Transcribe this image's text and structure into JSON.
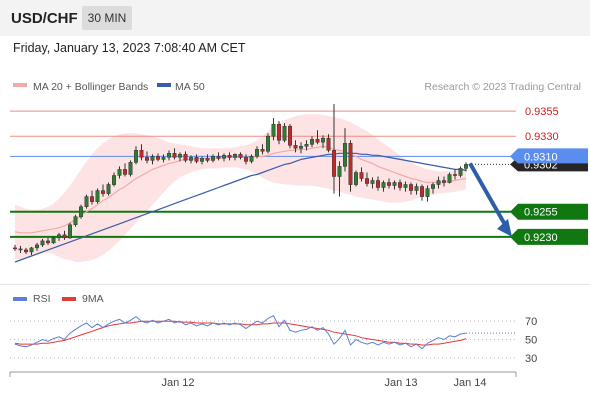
{
  "header": {
    "symbol": "USD/CHF",
    "timeframe": "30 MIN",
    "datetime": "Friday, January 13, 2023 7:08:40 AM CET"
  },
  "legend": {
    "ma20_bb": "MA 20 + Bollinger Bands",
    "ma50": "MA 50",
    "credit": "Research © 2023 Trading Central",
    "rsi": "RSI",
    "rsi_ma": "9MA"
  },
  "colors": {
    "candle_up": "#2e7d32",
    "candle_down": "#c62828",
    "ma20": "#f4a9a9",
    "ma50": "#3b5ca8",
    "bollinger_fill": "#fde3e3",
    "resistance": "#f28b82",
    "support": "#117711",
    "pivot": "#5b8def",
    "arrow": "#2f5ea8",
    "rsi": "#5b7fd6",
    "rsi_ma": "#e53935"
  },
  "chart_data": [
    {
      "type": "candlestick",
      "title": "USD/CHF 30 MIN",
      "ylim": [
        0.9205,
        0.9368
      ],
      "candles": [
        [
          0.9219,
          0.9222,
          0.9216,
          0.9218
        ],
        [
          0.9218,
          0.9221,
          0.9214,
          0.9217
        ],
        [
          0.9217,
          0.9219,
          0.9213,
          0.9215
        ],
        [
          0.9215,
          0.922,
          0.9212,
          0.9219
        ],
        [
          0.9219,
          0.9224,
          0.9216,
          0.9222
        ],
        [
          0.9222,
          0.9228,
          0.922,
          0.9226
        ],
        [
          0.9226,
          0.9229,
          0.9222,
          0.9224
        ],
        [
          0.9224,
          0.923,
          0.9223,
          0.9229
        ],
        [
          0.9229,
          0.9234,
          0.9226,
          0.9232
        ],
        [
          0.9232,
          0.9236,
          0.9227,
          0.9229
        ],
        [
          0.9229,
          0.9244,
          0.9228,
          0.9242
        ],
        [
          0.9242,
          0.9252,
          0.924,
          0.925
        ],
        [
          0.925,
          0.9262,
          0.9248,
          0.926
        ],
        [
          0.926,
          0.9272,
          0.9258,
          0.927
        ],
        [
          0.927,
          0.9276,
          0.9262,
          0.9265
        ],
        [
          0.9265,
          0.9278,
          0.9263,
          0.9276
        ],
        [
          0.9276,
          0.9282,
          0.927,
          0.9273
        ],
        [
          0.9273,
          0.9284,
          0.9271,
          0.9282
        ],
        [
          0.9282,
          0.9294,
          0.928,
          0.9291
        ],
        [
          0.9291,
          0.93,
          0.9288,
          0.9297
        ],
        [
          0.9297,
          0.9303,
          0.929,
          0.9292
        ],
        [
          0.9292,
          0.9306,
          0.929,
          0.9304
        ],
        [
          0.9304,
          0.932,
          0.9302,
          0.9316
        ],
        [
          0.9316,
          0.9322,
          0.9306,
          0.9309
        ],
        [
          0.9309,
          0.9315,
          0.9303,
          0.9306
        ],
        [
          0.9306,
          0.9312,
          0.9302,
          0.931
        ],
        [
          0.931,
          0.9313,
          0.9305,
          0.9307
        ],
        [
          0.9307,
          0.9312,
          0.9304,
          0.9309
        ],
        [
          0.9309,
          0.9316,
          0.9306,
          0.9313
        ],
        [
          0.9313,
          0.9318,
          0.9307,
          0.9309
        ],
        [
          0.9309,
          0.9314,
          0.9305,
          0.9312
        ],
        [
          0.9312,
          0.9315,
          0.9304,
          0.9306
        ],
        [
          0.9306,
          0.9311,
          0.9303,
          0.9309
        ],
        [
          0.9309,
          0.9312,
          0.9303,
          0.9305
        ],
        [
          0.9305,
          0.931,
          0.9302,
          0.9308
        ],
        [
          0.9308,
          0.9312,
          0.9304,
          0.9306
        ],
        [
          0.9306,
          0.9312,
          0.9304,
          0.931
        ],
        [
          0.931,
          0.9314,
          0.9306,
          0.9308
        ],
        [
          0.9308,
          0.9313,
          0.9305,
          0.9311
        ],
        [
          0.9311,
          0.9314,
          0.9306,
          0.9309
        ],
        [
          0.9309,
          0.9313,
          0.9306,
          0.9312
        ],
        [
          0.9312,
          0.9314,
          0.9307,
          0.9309
        ],
        [
          0.9309,
          0.9312,
          0.9302,
          0.9305
        ],
        [
          0.9305,
          0.9312,
          0.9303,
          0.931
        ],
        [
          0.931,
          0.932,
          0.9308,
          0.9317
        ],
        [
          0.9317,
          0.9322,
          0.9312,
          0.9315
        ],
        [
          0.9315,
          0.9333,
          0.9313,
          0.933
        ],
        [
          0.933,
          0.9348,
          0.9326,
          0.9342
        ],
        [
          0.9342,
          0.9345,
          0.9322,
          0.9326
        ],
        [
          0.9326,
          0.9343,
          0.9324,
          0.934
        ],
        [
          0.934,
          0.9342,
          0.9318,
          0.9321
        ],
        [
          0.9321,
          0.9326,
          0.9314,
          0.9318
        ],
        [
          0.9318,
          0.9324,
          0.9313,
          0.932
        ],
        [
          0.932,
          0.9326,
          0.9316,
          0.9322
        ],
        [
          0.9322,
          0.933,
          0.9319,
          0.9327
        ],
        [
          0.9327,
          0.9336,
          0.9322,
          0.9324
        ],
        [
          0.9324,
          0.9331,
          0.9318,
          0.9328
        ],
        [
          0.9328,
          0.9332,
          0.9314,
          0.9316
        ],
        [
          0.9316,
          0.9362,
          0.9273,
          0.929
        ],
        [
          0.929,
          0.9305,
          0.927,
          0.93
        ],
        [
          0.93,
          0.9338,
          0.9295,
          0.9323
        ],
        [
          0.9323,
          0.9326,
          0.9275,
          0.9282
        ],
        [
          0.9282,
          0.9296,
          0.928,
          0.9294
        ],
        [
          0.9294,
          0.9299,
          0.9285,
          0.9288
        ],
        [
          0.9288,
          0.9294,
          0.928,
          0.9283
        ],
        [
          0.9283,
          0.9289,
          0.9278,
          0.9286
        ],
        [
          0.9286,
          0.929,
          0.9276,
          0.9279
        ],
        [
          0.9279,
          0.9286,
          0.9275,
          0.9284
        ],
        [
          0.9284,
          0.9288,
          0.9278,
          0.9281
        ],
        [
          0.9281,
          0.9286,
          0.9277,
          0.9284
        ],
        [
          0.9284,
          0.9287,
          0.9276,
          0.9279
        ],
        [
          0.9279,
          0.9285,
          0.9275,
          0.9282
        ],
        [
          0.9282,
          0.9284,
          0.9272,
          0.9276
        ],
        [
          0.9276,
          0.9283,
          0.9272,
          0.928
        ],
        [
          0.928,
          0.9282,
          0.9266,
          0.927
        ],
        [
          0.927,
          0.9281,
          0.9265,
          0.9278
        ],
        [
          0.9278,
          0.9284,
          0.9273,
          0.9282
        ],
        [
          0.9282,
          0.929,
          0.9278,
          0.9286
        ],
        [
          0.9286,
          0.929,
          0.928,
          0.9284
        ],
        [
          0.9284,
          0.9294,
          0.9283,
          0.9292
        ],
        [
          0.9292,
          0.9297,
          0.9287,
          0.9291
        ],
        [
          0.9291,
          0.93,
          0.9289,
          0.9298
        ],
        [
          0.9298,
          0.9304,
          0.9295,
          0.9302
        ]
      ],
      "ma20": [
        0.9235,
        0.9234,
        0.9234,
        0.9234,
        0.9235,
        0.9236,
        0.9237,
        0.9238,
        0.9239,
        0.9241,
        0.9244,
        0.9247,
        0.9251,
        0.9255,
        0.9258,
        0.9262,
        0.9266,
        0.9269,
        0.9273,
        0.9277,
        0.928,
        0.9284,
        0.9288,
        0.9291,
        0.9294,
        0.9297,
        0.9299,
        0.9301,
        0.9303,
        0.9304,
        0.9306,
        0.9307,
        0.9307,
        0.9308,
        0.9308,
        0.9308,
        0.9308,
        0.9308,
        0.9309,
        0.9309,
        0.9309,
        0.9309,
        0.9309,
        0.9309,
        0.931,
        0.931,
        0.9311,
        0.9313,
        0.9314,
        0.9315,
        0.9316,
        0.9316,
        0.9317,
        0.9317,
        0.9318,
        0.9319,
        0.932,
        0.9319,
        0.9317,
        0.9316,
        0.9315,
        0.9312,
        0.931,
        0.9307,
        0.9305,
        0.9303,
        0.93,
        0.9298,
        0.9296,
        0.9294,
        0.9292,
        0.929,
        0.9288,
        0.9287,
        0.9285,
        0.9284,
        0.9284,
        0.9284,
        0.9284,
        0.9285,
        0.9286,
        0.9287,
        0.9288
      ],
      "ma50": [
        0.9205,
        0.9207,
        0.9209,
        0.9211,
        0.9213,
        0.9215,
        0.9217,
        0.9219,
        0.9221,
        0.9223,
        0.9225,
        0.9227,
        0.9229,
        0.9231,
        0.9233,
        0.9235,
        0.9237,
        0.9239,
        0.9241,
        0.9243,
        0.9245,
        0.9247,
        0.9249,
        0.9251,
        0.9253,
        0.9255,
        0.9257,
        0.9259,
        0.9261,
        0.9263,
        0.9265,
        0.9267,
        0.9269,
        0.9271,
        0.9273,
        0.9275,
        0.9277,
        0.9279,
        0.9281,
        0.9283,
        0.9285,
        0.9287,
        0.9289,
        0.9291,
        0.9292,
        0.9294,
        0.9296,
        0.9298,
        0.93,
        0.9302,
        0.9303,
        0.9305,
        0.9307,
        0.9308,
        0.9309,
        0.931,
        0.9311,
        0.9312,
        0.9312,
        0.9313,
        0.9313,
        0.9313,
        0.9313,
        0.9312,
        0.9312,
        0.9311,
        0.9311,
        0.931,
        0.9309,
        0.9308,
        0.9307,
        0.9306,
        0.9305,
        0.9304,
        0.9303,
        0.9302,
        0.9301,
        0.93,
        0.9299,
        0.9298,
        0.9297,
        0.9297,
        0.9296
      ],
      "bb_upper": [
        0.9262,
        0.926,
        0.9258,
        0.9257,
        0.9257,
        0.9258,
        0.926,
        0.9263,
        0.9268,
        0.9274,
        0.9281,
        0.9289,
        0.9297,
        0.9305,
        0.9312,
        0.9318,
        0.9323,
        0.9327,
        0.933,
        0.9332,
        0.9333,
        0.9333,
        0.9333,
        0.9332,
        0.9331,
        0.933,
        0.9328,
        0.9326,
        0.9324,
        0.9323,
        0.9322,
        0.9321,
        0.932,
        0.9319,
        0.9318,
        0.9318,
        0.9318,
        0.9318,
        0.9318,
        0.9318,
        0.9319,
        0.932,
        0.9321,
        0.9323,
        0.9326,
        0.933,
        0.9335,
        0.934,
        0.9343,
        0.9346,
        0.9348,
        0.935,
        0.9351,
        0.9352,
        0.9352,
        0.9352,
        0.9351,
        0.935,
        0.9349,
        0.9348,
        0.9346,
        0.9344,
        0.9341,
        0.9338,
        0.9335,
        0.9331,
        0.9327,
        0.9323,
        0.9319,
        0.9315,
        0.9311,
        0.9307,
        0.9304,
        0.9301,
        0.9299,
        0.9297,
        0.9296,
        0.9295,
        0.9295,
        0.9295,
        0.9296,
        0.9297,
        0.9298
      ],
      "bb_lower": [
        0.9208,
        0.9208,
        0.921,
        0.9211,
        0.9213,
        0.9214,
        0.9214,
        0.9213,
        0.921,
        0.9208,
        0.9207,
        0.9205,
        0.9205,
        0.9206,
        0.9207,
        0.9209,
        0.9212,
        0.9216,
        0.9221,
        0.9226,
        0.9232,
        0.9238,
        0.9244,
        0.925,
        0.9256,
        0.9262,
        0.9268,
        0.9274,
        0.928,
        0.9285,
        0.9289,
        0.9292,
        0.9294,
        0.9296,
        0.9297,
        0.9298,
        0.9298,
        0.9298,
        0.9299,
        0.9299,
        0.9299,
        0.9298,
        0.9297,
        0.9295,
        0.9292,
        0.9289,
        0.9286,
        0.9284,
        0.9283,
        0.9282,
        0.9282,
        0.9281,
        0.9281,
        0.9281,
        0.9281,
        0.928,
        0.9279,
        0.9278,
        0.9276,
        0.9275,
        0.9273,
        0.9272,
        0.927,
        0.9269,
        0.9268,
        0.9267,
        0.9266,
        0.9265,
        0.9264,
        0.9264,
        0.9264,
        0.9265,
        0.9266,
        0.9268,
        0.927,
        0.9271,
        0.9272,
        0.9273,
        0.9274,
        0.9274,
        0.9275,
        0.9276,
        0.9277
      ],
      "levels": [
        {
          "label": "0.9355",
          "value": 0.9355,
          "kind": "resistance"
        },
        {
          "label": "0.9330",
          "value": 0.933,
          "kind": "resistance"
        },
        {
          "label": "0.9310",
          "value": 0.931,
          "kind": "pivot"
        },
        {
          "label": "0.9255",
          "value": 0.9255,
          "kind": "support"
        },
        {
          "label": "0.9230",
          "value": 0.923,
          "kind": "support"
        }
      ],
      "last_price": {
        "label": "0.9302",
        "value": 0.9302
      },
      "forecast_arrow": {
        "from": 0.9303,
        "to": 0.923,
        "direction": "down"
      }
    },
    {
      "type": "line",
      "title": "RSI",
      "ylim": [
        20,
        80
      ],
      "yticks": [
        "70",
        "50",
        "30"
      ],
      "ytick_values": [
        70,
        50,
        30
      ],
      "series": [
        {
          "name": "RSI",
          "values": [
            45,
            43,
            42,
            44,
            47,
            50,
            48,
            51,
            53,
            50,
            57,
            61,
            65,
            68,
            63,
            67,
            63,
            67,
            70,
            72,
            68,
            71,
            75,
            70,
            68,
            71,
            68,
            70,
            72,
            68,
            70,
            66,
            68,
            65,
            67,
            65,
            68,
            66,
            68,
            66,
            68,
            66,
            62,
            66,
            70,
            68,
            73,
            76,
            64,
            71,
            60,
            58,
            60,
            61,
            64,
            60,
            63,
            56,
            45,
            51,
            60,
            44,
            50,
            47,
            45,
            47,
            44,
            47,
            45,
            47,
            44,
            46,
            42,
            45,
            40,
            46,
            49,
            52,
            50,
            54,
            53,
            56,
            57
          ]
        },
        {
          "name": "9MA",
          "values": [
            46,
            45,
            45,
            45,
            45,
            46,
            46,
            47,
            48,
            49,
            51,
            53,
            55,
            57,
            59,
            61,
            63,
            65,
            66,
            67,
            68,
            68,
            69,
            70,
            70,
            70,
            70,
            70,
            70,
            70,
            69,
            69,
            69,
            68,
            68,
            68,
            68,
            67,
            67,
            67,
            67,
            67,
            66,
            66,
            66,
            67,
            67,
            68,
            68,
            68,
            67,
            66,
            65,
            64,
            63,
            62,
            61,
            60,
            58,
            57,
            56,
            55,
            54,
            52,
            51,
            50,
            49,
            48,
            47,
            47,
            46,
            46,
            45,
            45,
            44,
            44,
            45,
            45,
            46,
            47,
            48,
            49,
            51
          ]
        }
      ]
    }
  ],
  "xaxis": {
    "tick_labels": [
      "Jan 12",
      "Jan 13",
      "Jan 14"
    ]
  }
}
